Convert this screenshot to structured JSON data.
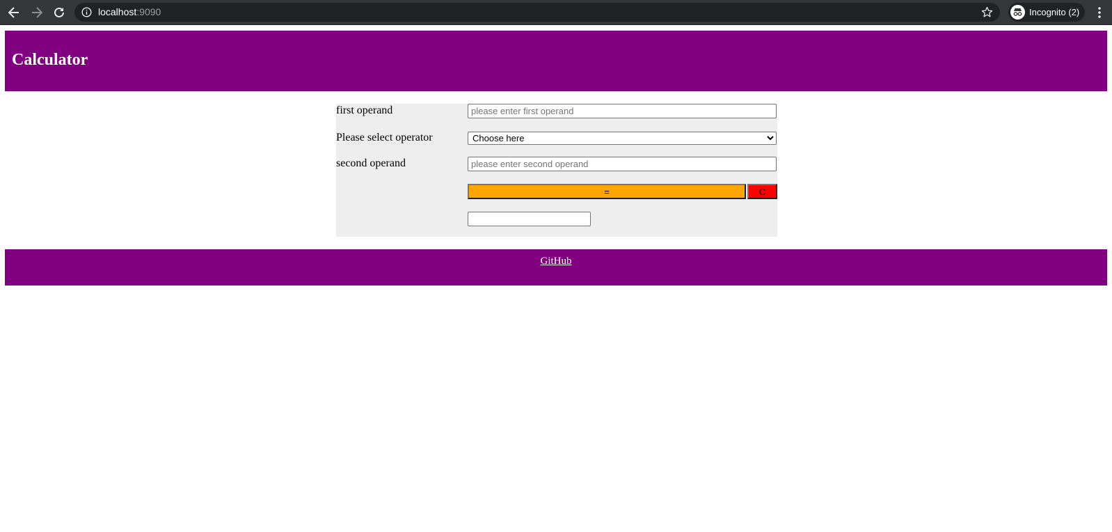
{
  "browser": {
    "url_host": "localhost",
    "url_port": ":9090",
    "profile_label": "Incognito (2)",
    "icons": [
      "back-arrow-icon",
      "forward-arrow-icon",
      "reload-icon",
      "info-icon",
      "star-icon",
      "incognito-icon",
      "kebab-menu-icon"
    ]
  },
  "header": {
    "title": "Calculator",
    "background": "#800080"
  },
  "form": {
    "first_operand_label": "first operand",
    "first_operand_placeholder": "please enter first operand",
    "first_operand_value": "",
    "operator_label": "Please select operator",
    "operator_selected": "Choose here",
    "second_operand_label": "second operand",
    "second_operand_placeholder": "please enter second operand",
    "second_operand_value": "",
    "equals_label": "=",
    "clear_label": "C",
    "result_value": "",
    "panel_background": "#eeeeee",
    "equals_color": "#ffa500",
    "clear_color": "#ff0000"
  },
  "footer": {
    "link_label": "GitHub",
    "background": "#800080"
  }
}
